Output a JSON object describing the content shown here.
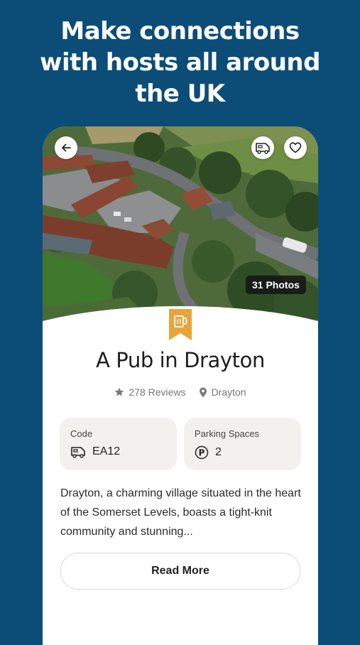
{
  "headline": [
    "Make connections",
    "with hosts all around",
    "the UK"
  ],
  "listing": {
    "photos_count": "31 Photos",
    "title": "A Pub in Drayton",
    "reviews": "278 Reviews",
    "location": "Drayton",
    "code_label": "Code",
    "code_value": "EA12",
    "parking_label": "Parking Spaces",
    "parking_value": "2",
    "description": "Drayton, a charming village situated in the heart of the Somerset Levels, boasts a tight-knit community and stunning...",
    "read_more": "Read More"
  },
  "icons": {
    "back": "arrow-left-icon",
    "motorhome": "motorhome-icon",
    "favourite": "heart-icon",
    "category": "beer-mug-icon",
    "star": "star-icon",
    "location": "map-pin-icon",
    "parking": "parking-icon"
  },
  "colors": {
    "background": "#0c4d78",
    "ribbon": "#e8a43a",
    "card": "#f3f1ee"
  }
}
